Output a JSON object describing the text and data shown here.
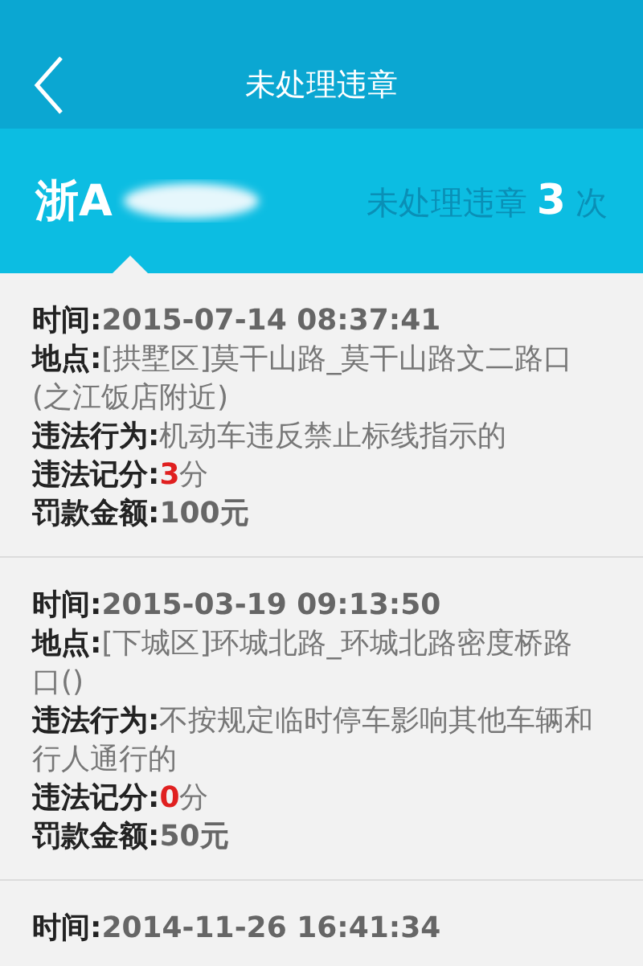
{
  "header": {
    "title": "未处理违章"
  },
  "summary": {
    "plate": "浙A",
    "label": "未处理违章",
    "count": "3",
    "unit": "次"
  },
  "records": [
    {
      "fields": [
        {
          "kind": "time",
          "label": "时间:",
          "value": "2015-07-14 08:37:41"
        },
        {
          "kind": "text",
          "label": "地点:",
          "value": "[拱墅区]莫干山路_莫干山路文二路口(之江饭店附近)"
        },
        {
          "kind": "text",
          "label": "违法行为:",
          "value": "机动车违反禁止标线指示的"
        },
        {
          "kind": "score",
          "label": "违法记分:",
          "value": "3",
          "unit": "分"
        },
        {
          "kind": "amount",
          "label": "罚款金额:",
          "value": "100元"
        }
      ]
    },
    {
      "fields": [
        {
          "kind": "time",
          "label": "时间:",
          "value": "2015-03-19 09:13:50"
        },
        {
          "kind": "text",
          "label": "地点:",
          "value": "[下城区]环城北路_环城北路密度桥路口()"
        },
        {
          "kind": "text",
          "label": "违法行为:",
          "value": "不按规定临时停车影响其他车辆和行人通行的"
        },
        {
          "kind": "score",
          "label": "违法记分:",
          "value": "0",
          "unit": "分"
        },
        {
          "kind": "amount",
          "label": "罚款金额:",
          "value": "50元"
        }
      ]
    },
    {
      "fields": [
        {
          "kind": "time",
          "label": "时间:",
          "value": "2014-11-26 16:41:34"
        }
      ]
    }
  ]
}
